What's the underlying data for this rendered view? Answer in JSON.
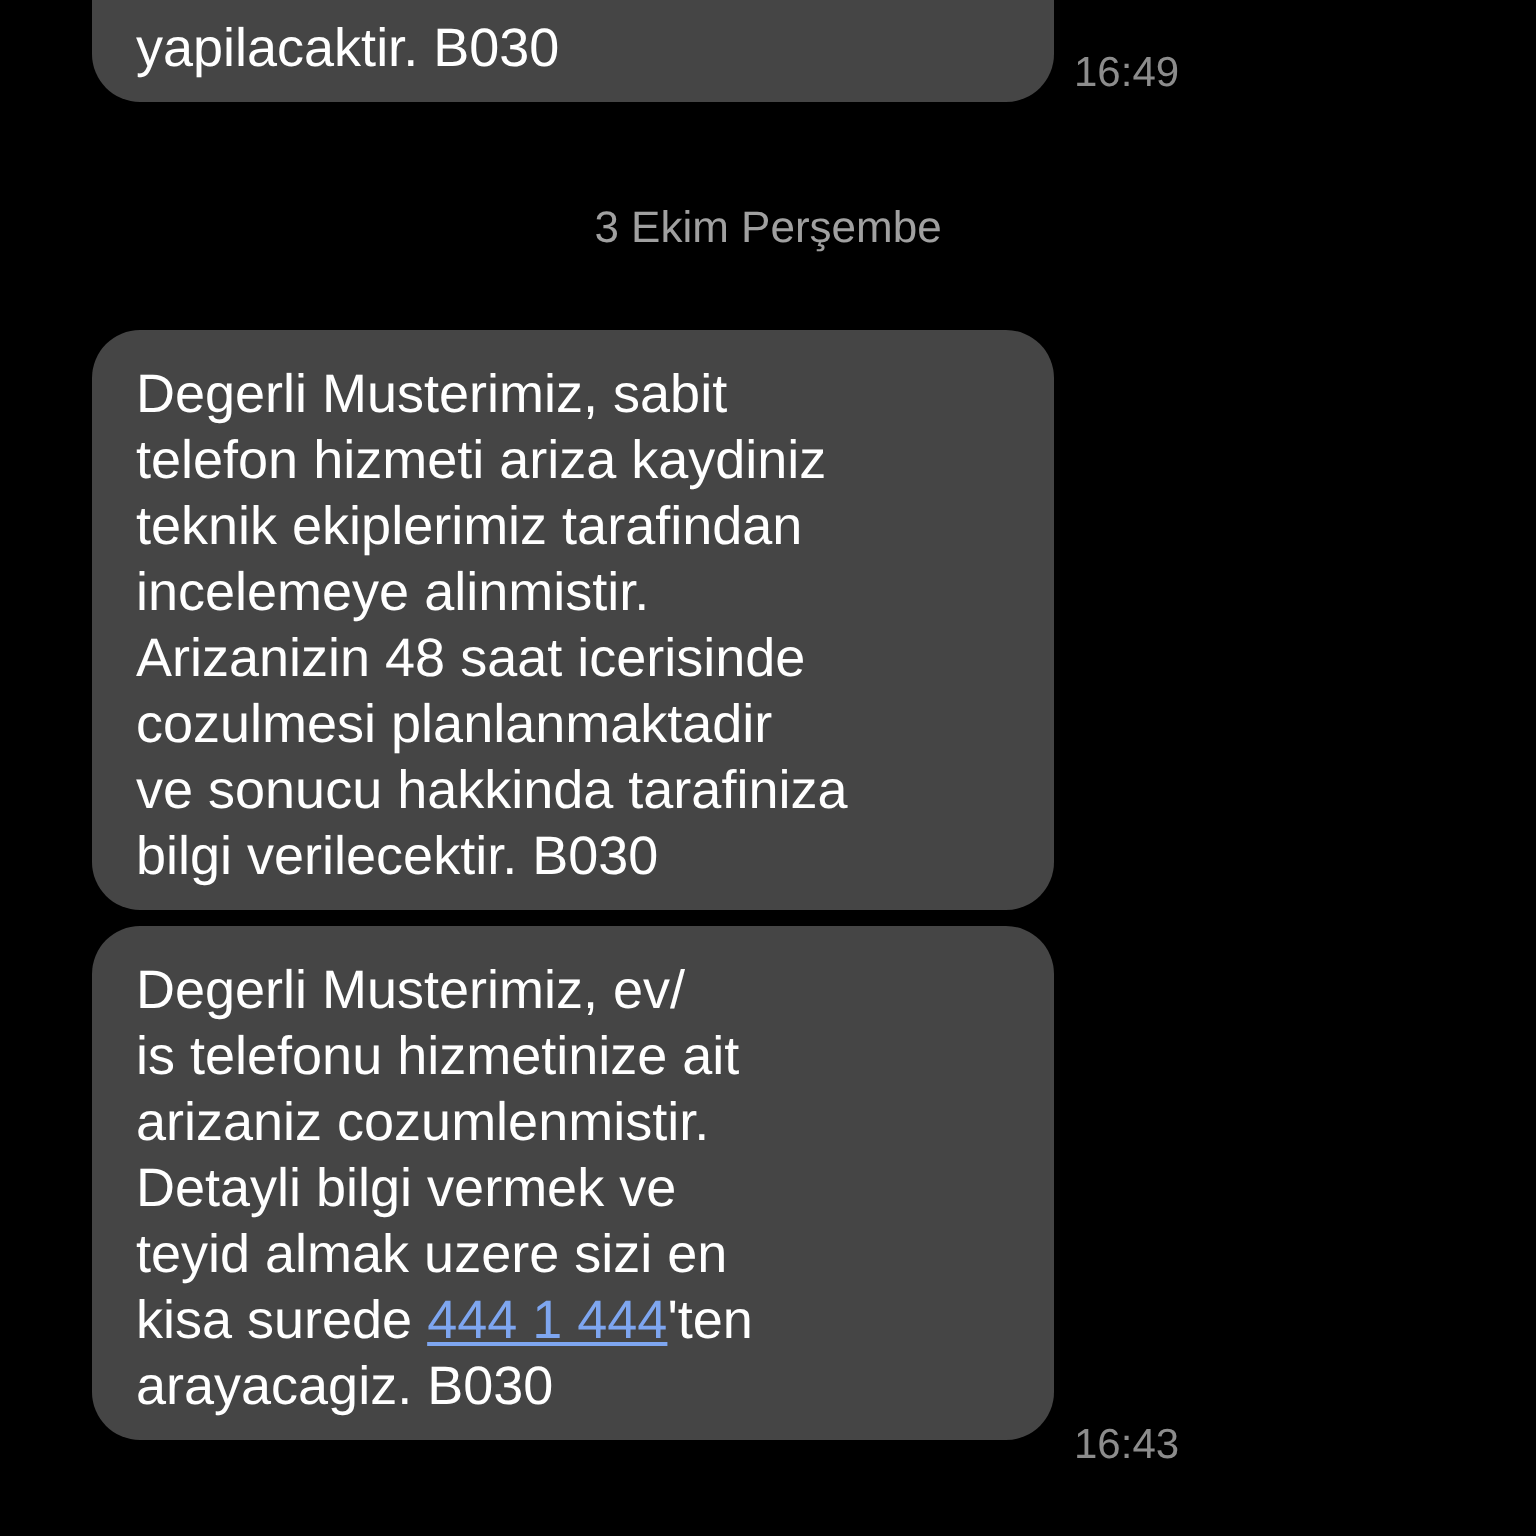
{
  "messages": [
    {
      "kind": "message",
      "text": "yapilacaktir. B030",
      "time": "16:49"
    },
    {
      "kind": "date",
      "text": "3 Ekim Perşembe"
    },
    {
      "kind": "message",
      "text": "Degerli Musterimiz, sabit\ntelefon hizmeti ariza kaydiniz\nteknik ekiplerimiz tarafindan\nincelemeye alinmistir.\nArizanizin 48 saat icerisinde\ncozulmesi planlanmaktadir\nve sonucu hakkinda tarafiniza\nbilgi verilecektir. B030"
    },
    {
      "kind": "message",
      "text": "Degerli Musterimiz, ev/\nis telefonu hizmetinize ait\narizaniz cozumlenmistir.\nDetayli bilgi vermek ve\nteyid almak uzere sizi en\nkisa surede ",
      "link": "444 1 444",
      "text_after": "'ten\narayacagiz. B030",
      "time": "16:43"
    }
  ]
}
